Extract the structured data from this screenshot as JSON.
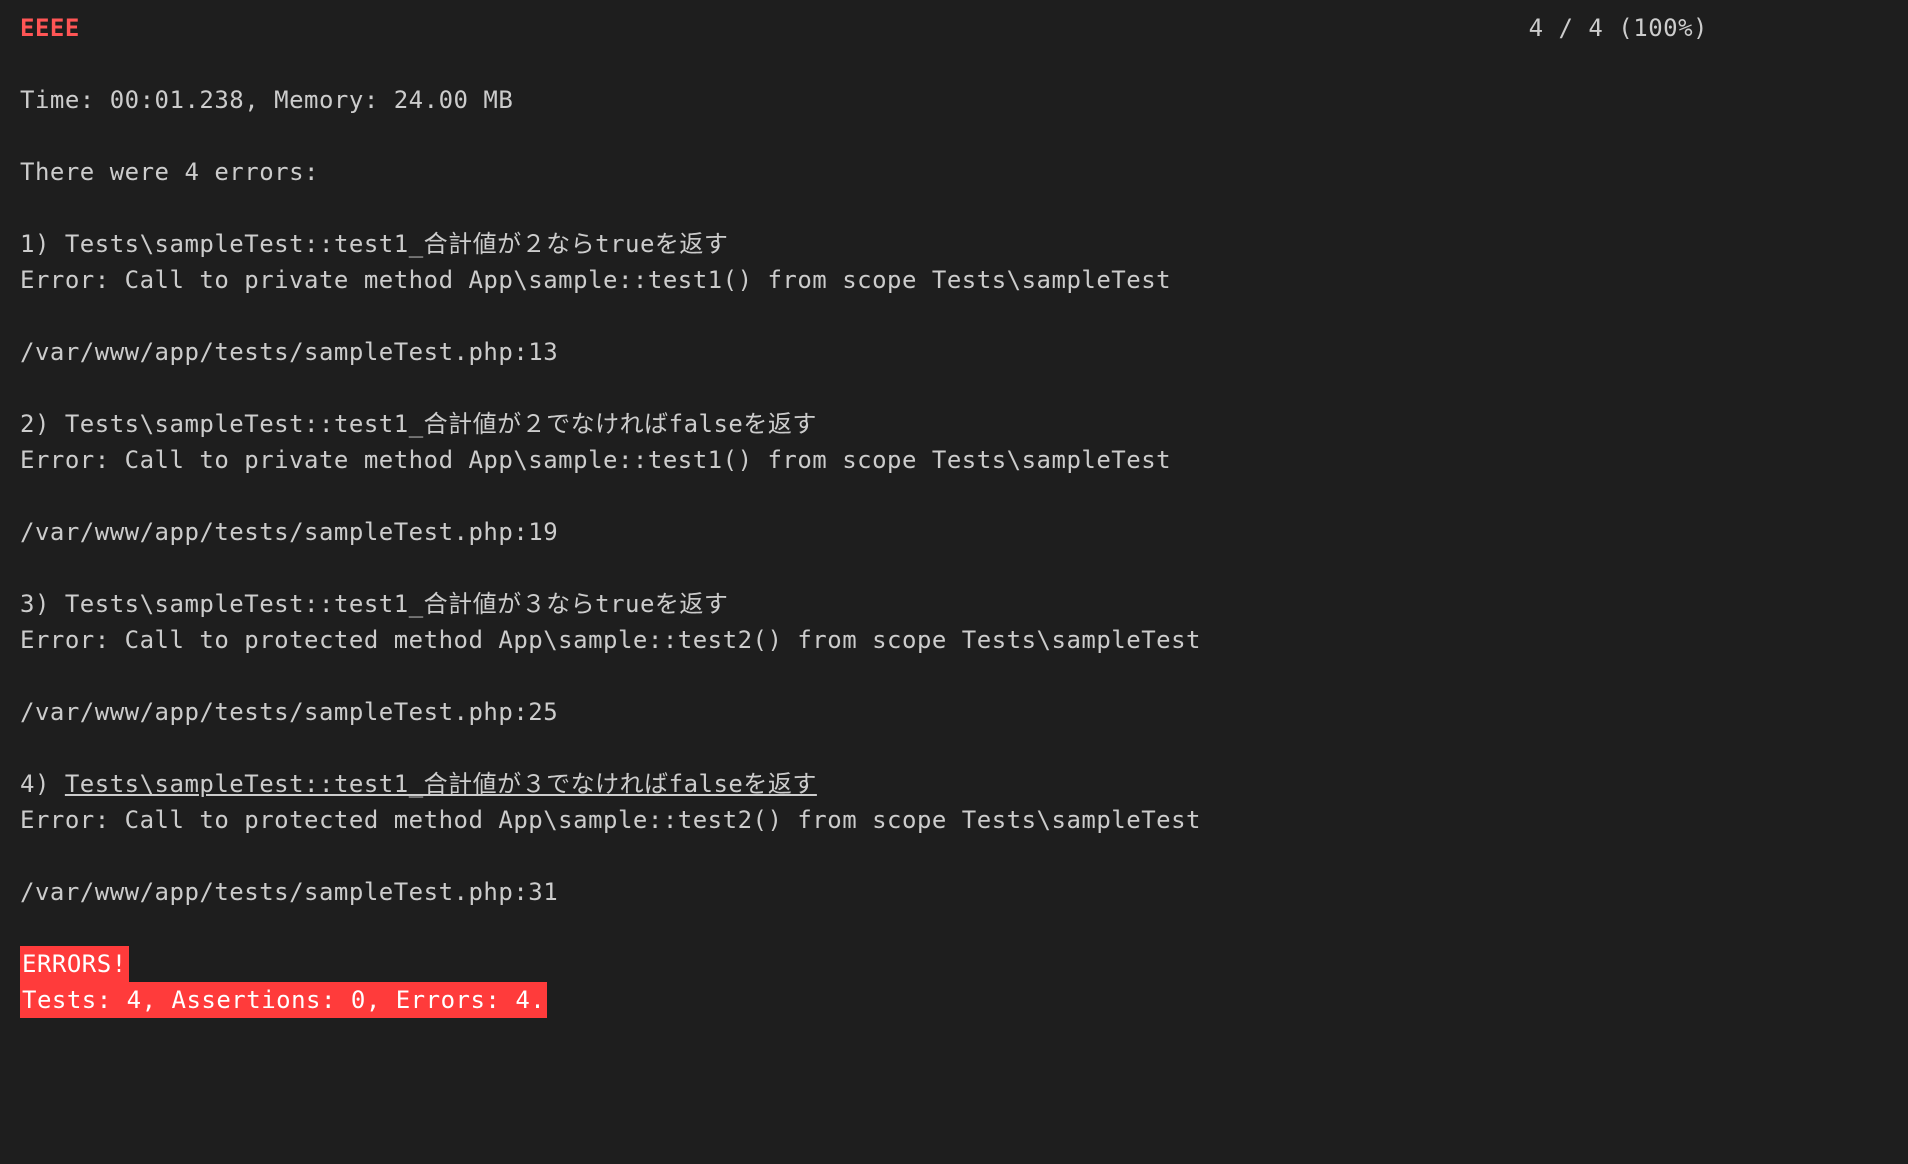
{
  "top": {
    "markers": "EEEE",
    "progress": "4 / 4 (100%)"
  },
  "time_memory": "Time: 00:01.238, Memory: 24.00 MB",
  "errors_header": "There were 4 errors:",
  "errors": [
    {
      "num": "1)",
      "name": "Tests\\sampleTest::test1_合計値が２ならtrueを返す",
      "msg": "Error: Call to private method App\\sample::test1() from scope Tests\\sampleTest",
      "loc": "/var/www/app/tests/sampleTest.php:13",
      "underlined": false
    },
    {
      "num": "2)",
      "name": "Tests\\sampleTest::test1_合計値が２でなければfalseを返す",
      "msg": "Error: Call to private method App\\sample::test1() from scope Tests\\sampleTest",
      "loc": "/var/www/app/tests/sampleTest.php:19",
      "underlined": false
    },
    {
      "num": "3)",
      "name": "Tests\\sampleTest::test1_合計値が３ならtrueを返す",
      "msg": "Error: Call to protected method App\\sample::test2() from scope Tests\\sampleTest",
      "loc": "/var/www/app/tests/sampleTest.php:25",
      "underlined": false
    },
    {
      "num": "4)",
      "name": "Tests\\sampleTest::test1_合計値が３でなければfalseを返す",
      "msg": "Error: Call to protected method App\\sample::test2() from scope Tests\\sampleTest",
      "loc": "/var/www/app/tests/sampleTest.php:31",
      "underlined": true
    }
  ],
  "summary": {
    "errors_label": "ERRORS!",
    "stats": "Tests: 4, Assertions: 0, Errors: 4."
  }
}
